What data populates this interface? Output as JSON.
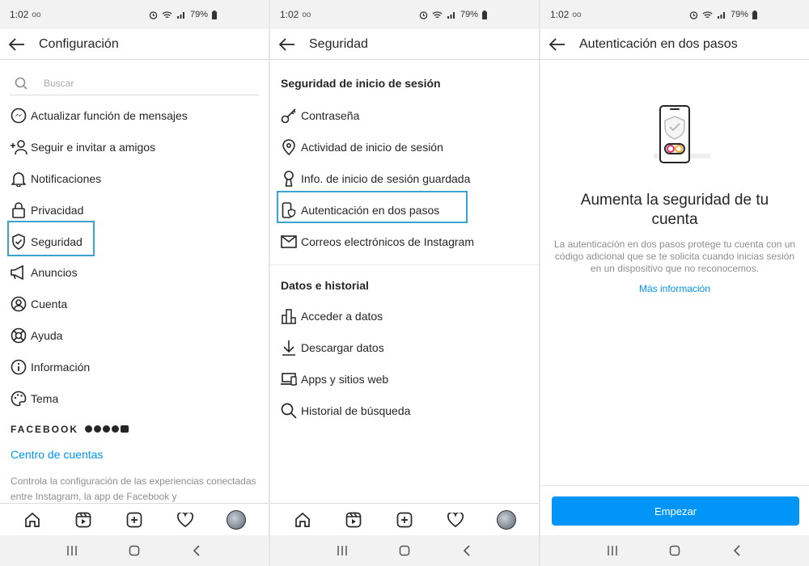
{
  "status": {
    "time": "1:02",
    "voicemail": "oo",
    "battery": "79%"
  },
  "screen1": {
    "title": "Configuración",
    "search_placeholder": "Buscar",
    "items": [
      {
        "label": "Actualizar función de mensajes",
        "icon": "messenger-icon"
      },
      {
        "label": "Seguir e invitar a amigos",
        "icon": "add-person-icon"
      },
      {
        "label": "Notificaciones",
        "icon": "bell-icon"
      },
      {
        "label": "Privacidad",
        "icon": "lock-icon"
      },
      {
        "label": "Seguridad",
        "icon": "shield-check-icon"
      },
      {
        "label": "Anuncios",
        "icon": "megaphone-icon"
      },
      {
        "label": "Cuenta",
        "icon": "person-circle-icon"
      },
      {
        "label": "Ayuda",
        "icon": "lifebuoy-icon"
      },
      {
        "label": "Información",
        "icon": "info-icon"
      },
      {
        "label": "Tema",
        "icon": "palette-icon"
      }
    ],
    "brand": "FACEBOOK",
    "accounts_center": "Centro de cuentas",
    "description": "Controla la configuración de las experiencias conectadas entre Instagram, la app de Facebook y"
  },
  "screen2": {
    "title": "Seguridad",
    "section1": "Seguridad de inicio de sesión",
    "items1": [
      {
        "label": "Contraseña",
        "icon": "key-icon"
      },
      {
        "label": "Actividad de inicio de sesión",
        "icon": "location-pin-icon"
      },
      {
        "label": "Info. de inicio de sesión guardada",
        "icon": "keyhole-icon"
      },
      {
        "label": "Autenticación en dos pasos",
        "icon": "phone-shield-icon"
      },
      {
        "label": "Correos electrónicos de Instagram",
        "icon": "mail-icon"
      }
    ],
    "section2": "Datos e historial",
    "items2": [
      {
        "label": "Acceder a datos",
        "icon": "bar-chart-icon"
      },
      {
        "label": "Descargar datos",
        "icon": "download-icon"
      },
      {
        "label": "Apps y sitios web",
        "icon": "laptop-icon"
      },
      {
        "label": "Historial de búsqueda",
        "icon": "search-icon"
      }
    ]
  },
  "screen3": {
    "title": "Autenticación en dos pasos",
    "heading": "Aumenta la seguridad de tu cuenta",
    "description": "La autenticación en dos pasos protege tu cuenta con un código adicional que se te solicita cuando inicias sesión en un dispositivo que no reconocemos.",
    "more_info": "Más información",
    "button": "Empezar"
  },
  "colors": {
    "accent": "#0095f6",
    "highlight": "#3aa3d0",
    "text": "#262626",
    "muted": "#8e8e8e"
  }
}
